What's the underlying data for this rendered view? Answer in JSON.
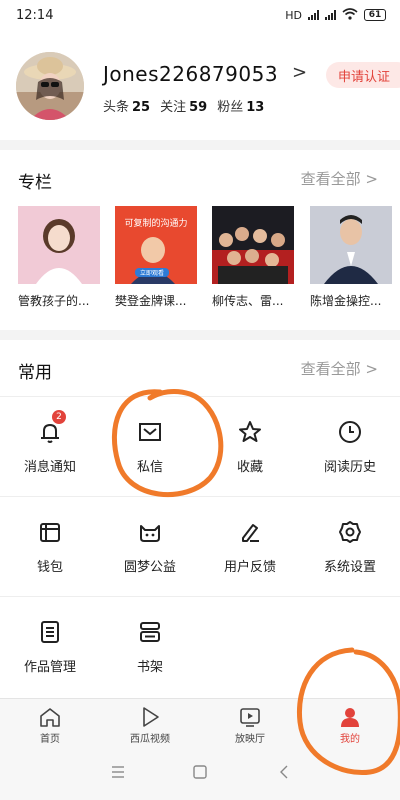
{
  "status_bar": {
    "time": "12:14",
    "network": "HD",
    "battery": "61"
  },
  "profile": {
    "username": "Jones226879053",
    "stats": [
      {
        "label": "头条",
        "value": "25"
      },
      {
        "label": "关注",
        "value": "59"
      },
      {
        "label": "粉丝",
        "value": "13"
      }
    ],
    "apply_label": "申请认证"
  },
  "columns": {
    "title": "专栏",
    "view_all": "查看全部",
    "thumb_texts": {
      "banner": "可复制的沟通力",
      "tag": "立即观看"
    },
    "items": [
      {
        "caption": "管教孩子的..."
      },
      {
        "caption": "樊登金牌课..."
      },
      {
        "caption": "柳传志、雷..."
      },
      {
        "caption": "陈增金操控..."
      }
    ]
  },
  "common": {
    "title": "常用",
    "view_all": "查看全部",
    "items": [
      {
        "label": "消息通知",
        "icon": "bell-icon",
        "badge": "2"
      },
      {
        "label": "私信",
        "icon": "mail-icon"
      },
      {
        "label": "收藏",
        "icon": "star-icon"
      },
      {
        "label": "阅读历史",
        "icon": "clock-icon"
      },
      {
        "label": "钱包",
        "icon": "wallet-icon"
      },
      {
        "label": "圆梦公益",
        "icon": "cat-face-icon"
      },
      {
        "label": "用户反馈",
        "icon": "pencil-icon"
      },
      {
        "label": "系统设置",
        "icon": "gear-icon"
      },
      {
        "label": "作品管理",
        "icon": "list-doc-icon"
      },
      {
        "label": "书架",
        "icon": "bookshelf-icon"
      }
    ]
  },
  "tabbar": {
    "items": [
      {
        "label": "首页",
        "icon": "home-icon"
      },
      {
        "label": "西瓜视频",
        "icon": "play-icon"
      },
      {
        "label": "放映厅",
        "icon": "tv-play-icon"
      },
      {
        "label": "我的",
        "icon": "user-icon",
        "active": true
      }
    ]
  },
  "colors": {
    "accent": "#e2433b",
    "annotation": "#f07a2a"
  }
}
